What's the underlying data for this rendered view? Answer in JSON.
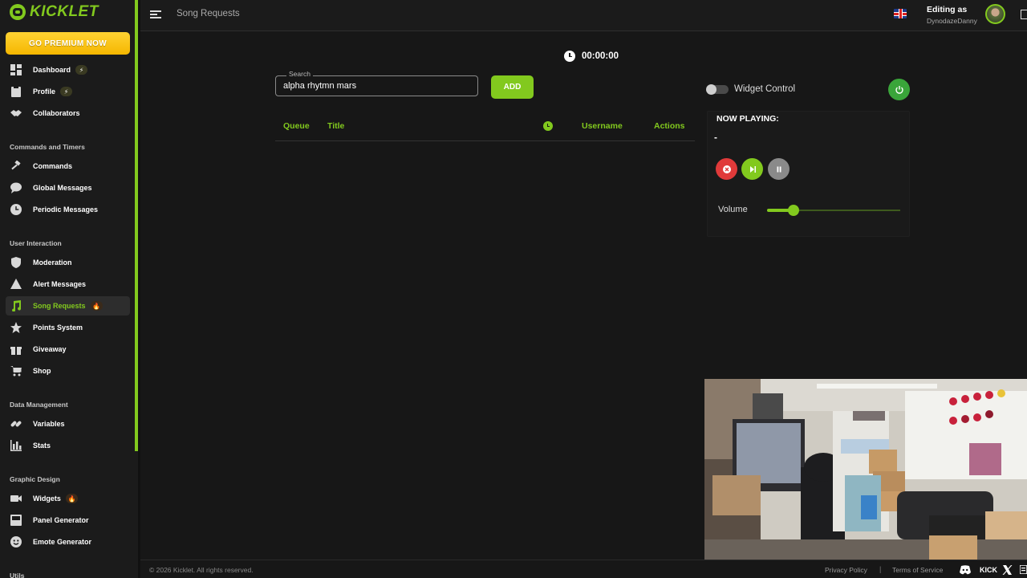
{
  "app": {
    "name": "KICKLET",
    "premium_label": "GO PREMIUM NOW"
  },
  "sidebar": {
    "items": [
      {
        "label": "Dashboard",
        "icon": "dashboard-icon",
        "badge": "⚡"
      },
      {
        "label": "Profile",
        "icon": "profile-icon",
        "badge": "⚡"
      },
      {
        "label": "Collaborators",
        "icon": "handshake-icon"
      },
      {
        "label": "Commands",
        "icon": "gavel-icon"
      },
      {
        "label": "Global Messages",
        "icon": "chat-icon"
      },
      {
        "label": "Periodic Messages",
        "icon": "clock-icon"
      },
      {
        "label": "Moderation",
        "icon": "shield-icon"
      },
      {
        "label": "Alert Messages",
        "icon": "alert-icon"
      },
      {
        "label": "Song Requests",
        "icon": "music-icon",
        "badge": "🔥",
        "active": true
      },
      {
        "label": "Points System",
        "icon": "star-icon"
      },
      {
        "label": "Giveaway",
        "icon": "gift-icon"
      },
      {
        "label": "Shop",
        "icon": "cart-icon"
      },
      {
        "label": "Variables",
        "icon": "link-icon"
      },
      {
        "label": "Stats",
        "icon": "bar-chart-icon"
      },
      {
        "label": "Widgets",
        "icon": "video-icon",
        "badge": "🔥"
      },
      {
        "label": "Panel Generator",
        "icon": "panel-icon"
      },
      {
        "label": "Emote Generator",
        "icon": "emote-icon"
      }
    ],
    "sections": [
      "Commands and Timers",
      "User Interaction",
      "Data Management",
      "Graphic Design",
      "Utils"
    ]
  },
  "header": {
    "title": "Song Requests",
    "editing_label": "Editing as",
    "username": "DynodazeDanny"
  },
  "main": {
    "timer": "00:00:00",
    "search": {
      "legend": "Search",
      "value": "alpha rhytmn mars"
    },
    "add_label": "ADD",
    "table_headers": {
      "queue": "Queue",
      "title": "Title",
      "username": "Username",
      "actions": "Actions"
    },
    "widget_control_label": "Widget Control",
    "now_playing": {
      "title": "NOW PLAYING:",
      "track": "-",
      "volume_label": "Volume",
      "volume": 0.2
    }
  },
  "footer": {
    "copyright": "© 2026 Kicklet. All rights reserved.",
    "privacy": "Privacy Policy",
    "separator": "|",
    "terms": "Terms of Service",
    "kick": "KICK"
  },
  "colors": {
    "accent": "#82c91e",
    "premium": "#f5b700",
    "danger": "#e03a3a",
    "power": "#3aa53a"
  }
}
